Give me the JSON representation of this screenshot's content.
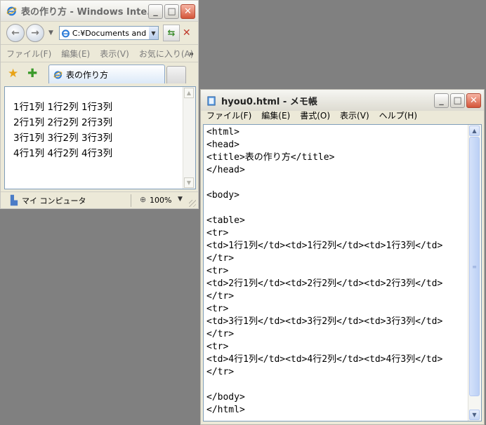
{
  "ie": {
    "window_title": "表の作り方 - Windows Inte...",
    "address": "C:¥Documents and S",
    "menu": [
      "ファイル(F)",
      "編集(E)",
      "表示(V)",
      "お気に入り(A)"
    ],
    "more_chevron": "»",
    "tab_title": "表の作り方",
    "content_lines": [
      "1行1列 1行2列 1行3列",
      "2行1列 2行2列 2行3列",
      "3行1列 3行2列 3行3列",
      "4行1列 4行2列 4行3列"
    ],
    "status_zone": "マイ コンピュータ",
    "zoom": "100%"
  },
  "notepad": {
    "window_title": "hyou0.html - メモ帳",
    "menu": [
      "ファイル(F)",
      "編集(E)",
      "書式(O)",
      "表示(V)",
      "ヘルプ(H)"
    ],
    "text": "<html>\n<head>\n<title>表の作り方</title>\n</head>\n\n<body>\n\n<table>\n<tr>\n<td>1行1列</td><td>1行2列</td><td>1行3列</td>\n</tr>\n<tr>\n<td>2行1列</td><td>2行2列</td><td>2行3列</td>\n</tr>\n<tr>\n<td>3行1列</td><td>3行2列</td><td>3行3列</td>\n</tr>\n<tr>\n<td>4行1列</td><td>4行2列</td><td>4行3列</td>\n</tr>\n\n</body>\n</html>"
  },
  "caption_glyphs": {
    "minimize": "_",
    "maximize": "□",
    "close": "✕"
  },
  "icons": [
    "ie-icon",
    "back-arrow-icon",
    "forward-arrow-icon",
    "refresh-icon",
    "stop-icon",
    "favorites-star-icon",
    "add-favorites-icon",
    "computer-icon",
    "zoom-icon",
    "notepad-icon"
  ]
}
